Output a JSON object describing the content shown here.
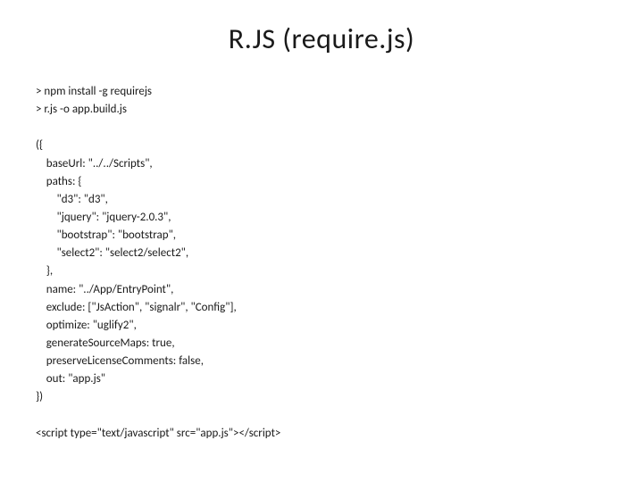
{
  "title": "R.JS (require.js)",
  "code": "> npm install -g requirejs\n> r.js -o app.build.js\n\n({\n    baseUrl: \"../../Scripts\",\n    paths: {\n        \"d3\": \"d3\",\n        \"jquery\": \"jquery-2.0.3\",\n        \"bootstrap\": \"bootstrap\",\n        \"select2\": \"select2/select2\",\n    },\n    name: \"../App/EntryPoint\",\n    exclude: [\"JsAction\", \"signalr\", \"Config\"],\n    optimize: \"uglify2\",\n    generateSourceMaps: true,\n    preserveLicenseComments: false,\n    out: \"app.js\"\n})\n\n<script type=\"text/javascript\" src=\"app.js\"></script>"
}
